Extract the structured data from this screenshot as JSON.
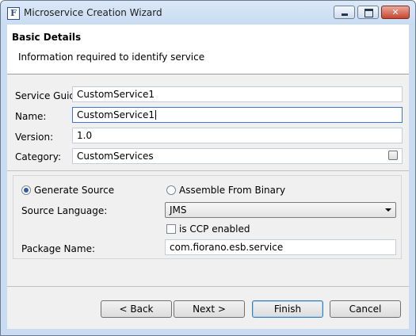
{
  "window": {
    "title": "Microservice Creation Wizard",
    "app_icon_letter": "F"
  },
  "header": {
    "title": "Basic Details",
    "description": "Information required to identify service"
  },
  "form": {
    "service_guid": {
      "label": "Service Guid:",
      "value": "CustomService1"
    },
    "name": {
      "label": "Name:",
      "value": "CustomService1"
    },
    "version": {
      "label": "Version:",
      "value": "1.0"
    },
    "category": {
      "label": "Category:",
      "value": "CustomServices"
    }
  },
  "source": {
    "generate_label": "Generate Source",
    "generate_selected": true,
    "assemble_label": "Assemble From Binary",
    "assemble_selected": false,
    "language_label": "Source Language:",
    "language_value": "JMS",
    "ccp_label": "is CCP enabled",
    "ccp_checked": false,
    "package_label": "Package Name:",
    "package_value": "com.fiorano.esb.service"
  },
  "buttons": {
    "back": "< Back",
    "next": "Next >",
    "finish": "Finish",
    "cancel": "Cancel"
  },
  "colors": {
    "focus_border": "#3d79c7",
    "radio_dot": "#2d5da8",
    "close_button": "#c9452d",
    "default_button_border": "#3c7fb1"
  }
}
